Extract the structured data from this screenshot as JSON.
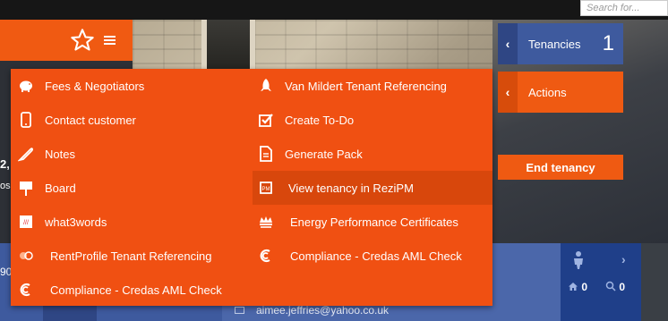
{
  "search": {
    "placeholder": "Search for..."
  },
  "header": {
    "fragment_bold": "2,",
    "fragment_small": "os",
    "fragment_bottom": "90"
  },
  "side_panel": {
    "tenancies_label": "Tenancies",
    "tenancies_count": "1",
    "actions_label": "Actions",
    "end_tenancy_label": "End tenancy"
  },
  "contact": {
    "email": "aimee.jeffries@yahoo.co.uk"
  },
  "stats": {
    "home_count": "0",
    "search_count": "0"
  },
  "menu": {
    "left": [
      {
        "label": "Fees & Negotiators",
        "icon": "piggy-bank-icon"
      },
      {
        "label": "Contact customer",
        "icon": "mobile-phone-icon"
      },
      {
        "label": "Notes",
        "icon": "feather-icon"
      },
      {
        "label": "Board",
        "icon": "board-sign-icon"
      },
      {
        "label": "what3words",
        "icon": "what3words-icon"
      },
      {
        "label": "RentProfile Tenant Referencing",
        "icon": "rentprofile-icon"
      },
      {
        "label": "Compliance - Credas AML Check",
        "icon": "credas-icon"
      }
    ],
    "right": [
      {
        "label": "Van Mildert Tenant Referencing",
        "icon": "rocket-icon"
      },
      {
        "label": "Create To-Do",
        "icon": "checkbox-icon"
      },
      {
        "label": "Generate Pack",
        "icon": "document-icon"
      },
      {
        "label": "View tenancy in ReziPM",
        "icon": "rezipm-icon"
      },
      {
        "label": "Energy Performance Certificates",
        "icon": "govuk-crown-icon"
      },
      {
        "label": "Compliance - Credas AML Check",
        "icon": "credas-icon"
      }
    ]
  },
  "colors": {
    "accent": "#f05012",
    "blue": "#3e5a9e",
    "highlight": "#d8470c"
  }
}
